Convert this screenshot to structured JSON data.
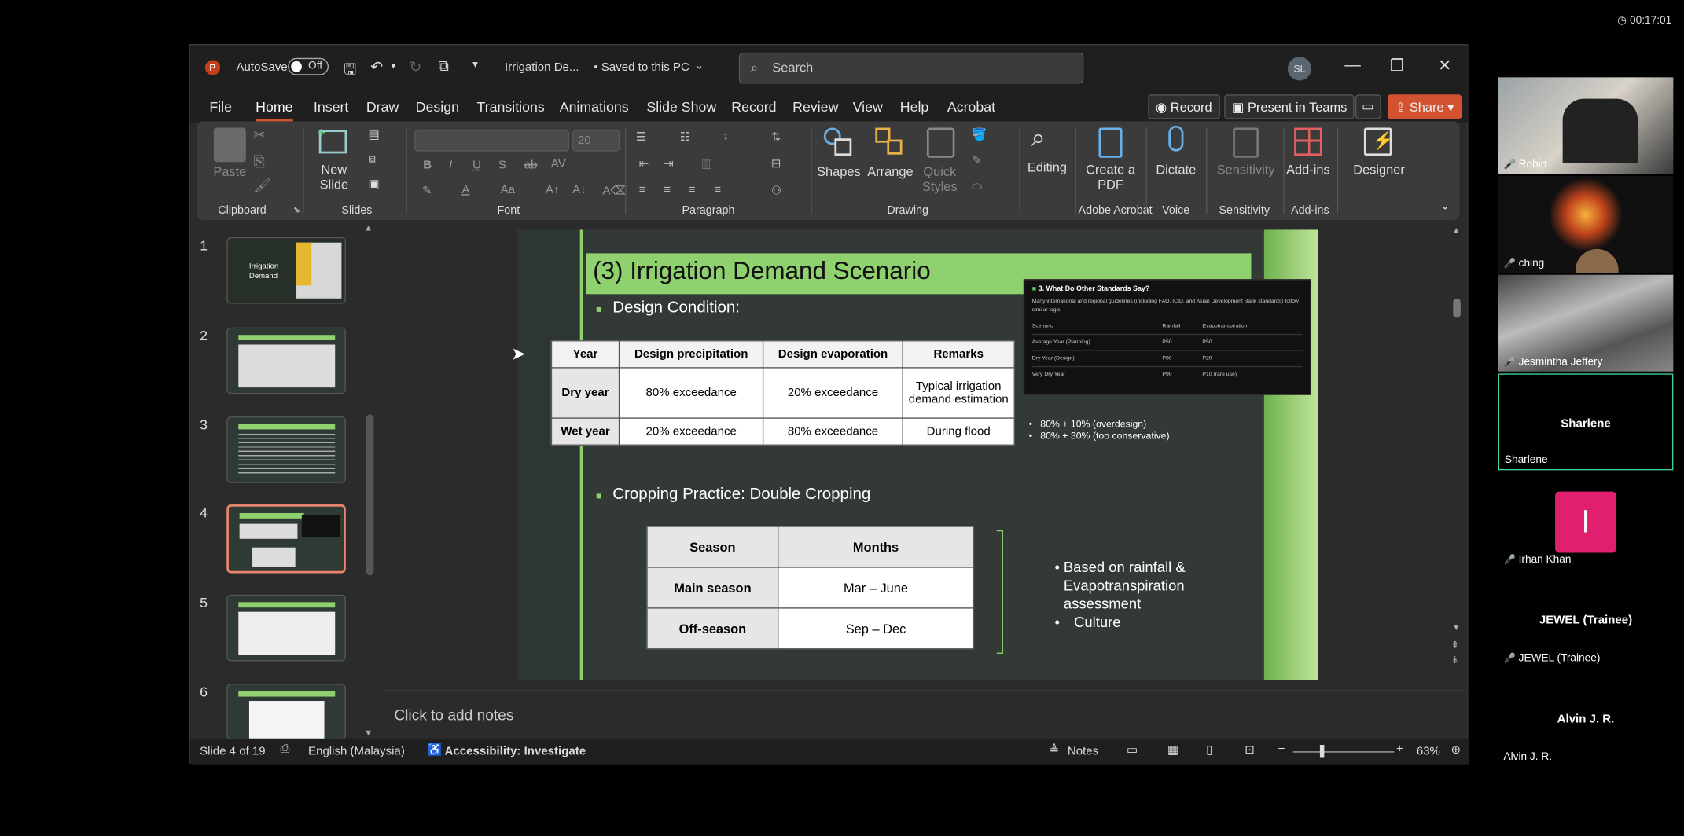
{
  "timer": "00:17:01",
  "titlebar": {
    "autosave_label": "AutoSave",
    "autosave_state": "Off",
    "filename": "Irrigation De...",
    "save_status": "• Saved to this PC",
    "search_placeholder": "Search",
    "user_initials": "SL"
  },
  "menu": {
    "items": [
      "File",
      "Home",
      "Insert",
      "Draw",
      "Design",
      "Transitions",
      "Animations",
      "Slide Show",
      "Record",
      "Review",
      "View",
      "Help",
      "Acrobat"
    ],
    "active": "Home",
    "record_btn": "Record",
    "teams_btn": "Present in Teams",
    "share_btn": "Share"
  },
  "ribbon": {
    "paste": "Paste",
    "new_slide": "New Slide",
    "font_size": "20",
    "shapes": "Shapes",
    "arrange": "Arrange",
    "quick_styles": "Quick Styles",
    "editing": "Editing",
    "create_pdf": "Create a PDF",
    "dictate": "Dictate",
    "sensitivity": "Sensitivity",
    "addins": "Add-ins",
    "designer": "Designer",
    "groups": {
      "clipboard": "Clipboard",
      "slides": "Slides",
      "font": "Font",
      "paragraph": "Paragraph",
      "drawing": "Drawing",
      "adobe": "Adobe Acrobat",
      "voice": "Voice",
      "sensitivity": "Sensitivity",
      "addins": "Add-ins"
    }
  },
  "thumbnails": {
    "numbers": [
      "1",
      "2",
      "3",
      "4",
      "5",
      "6"
    ],
    "slide1_title": "Irrigation Demand",
    "selected": "4"
  },
  "slide": {
    "title": "(3) Irrigation Demand Scenario",
    "bullet1": "Design Condition:",
    "table1": {
      "headers": [
        "Year",
        "Design precipitation",
        "Design evaporation",
        "Remarks"
      ],
      "rows": [
        [
          "Dry year",
          "80% exceedance",
          "20% exceedance",
          "Typical irrigation demand estimation"
        ],
        [
          "Wet year",
          "20% exceedance",
          "80% exceedance",
          "During flood"
        ]
      ]
    },
    "inset": {
      "title": "3. What Do Other Standards Say?",
      "text": "Many international and regional guidelines (including FAO, ICID, and Asian Development Bank standards) follow similar logic:",
      "headers": [
        "Scenario",
        "Rainfall",
        "Evapotranspiration"
      ],
      "rows": [
        [
          "Average Year (Planning)",
          "P50",
          "P50"
        ],
        [
          "Dry Year (Design)",
          "P80",
          "P20"
        ],
        [
          "Very Dry Year",
          "P90",
          "P10 (rare use)"
        ]
      ]
    },
    "notes_lines": [
      "80% + 10% (overdesign)",
      "80% + 30% (too conservative)"
    ],
    "bullet2": "Cropping Practice: Double Cropping",
    "table2": {
      "headers": [
        "Season",
        "Months"
      ],
      "rows": [
        [
          "Main season",
          "Mar – June"
        ],
        [
          "Off-season",
          "Sep – Dec"
        ]
      ]
    },
    "side_bullets": [
      "Based on rainfall & Evapotranspiration assessment",
      "Culture"
    ]
  },
  "notes_placeholder": "Click to add notes",
  "status": {
    "slide_info": "Slide 4 of 19",
    "language": "English (Malaysia)",
    "accessibility": "Accessibility: Investigate",
    "notes_btn": "Notes",
    "zoom": "63%"
  },
  "participants": [
    {
      "name": "Robin"
    },
    {
      "name": "ching"
    },
    {
      "name": "Jesmintha Jeffery"
    },
    {
      "name": "Sharlene",
      "center": "Sharlene"
    },
    {
      "name": "Irhan Khan",
      "initial": "I"
    },
    {
      "name": "JEWEL (Trainee)",
      "center": "JEWEL (Trainee)"
    },
    {
      "name": "Alvin J. R.",
      "center": "Alvin J. R."
    }
  ],
  "colors": {
    "accent": "#d35230",
    "slide_green": "#8fd06f",
    "avatar_pink": "#e0206e"
  }
}
